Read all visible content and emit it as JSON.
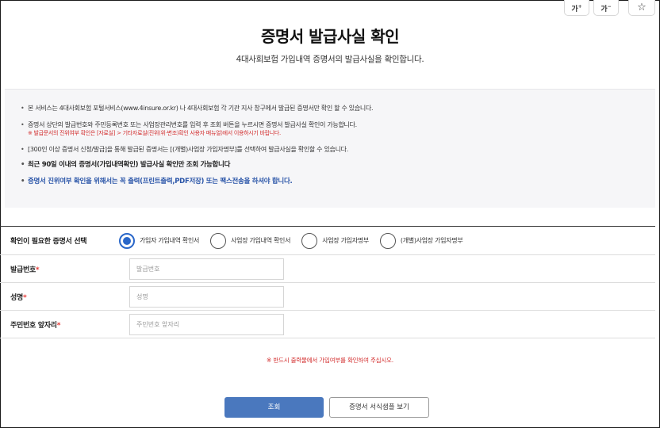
{
  "toolbar": {
    "font_up": "가",
    "font_up_mark": "+",
    "font_down": "가",
    "font_down_mark": "−",
    "favorite_glyph": "☆"
  },
  "header": {
    "title": "증명서 발급사실 확인",
    "subtitle": "4대사회보험 가입내역 증명서의 발급사실을 확인합니다."
  },
  "notice": {
    "item1": "본 서비스는 4대사회보험 포털서비스(www.4insure.or.kr) 나 4대사회보험 각 기관 지사 창구에서 발급된 증명서만 확인 할 수 있습니다.",
    "item2": "증명서 상단의 발급번호와 주민등록번호 또는 사업장관리번호를 입력 후 조회 버튼을 누르시면 증명서 발급사실 확인이 가능합니다.",
    "item2_note": "※ 발급문서의 진위여부 확인은 [자료실] > 기타자료실(진위(위·변조)확인 사용자 매뉴얼)에서 이용하시기 바랍니다.",
    "item3": "[300인 이상 증명서 신청/발급]을 통해 발급된 증명서는 [(개별)사업장 가입자명부]를 선택하여 발급사실을 확인할 수 있습니다.",
    "item4": "최근 90일 이내의 증명서(가입내역확인) 발급사실 확인만 조회 가능합니다",
    "item5": "증명서 진위여부 확인을 위해서는 꼭 출력(프린트출력,PDF저장) 또는 팩스전송을 하셔야 합니다."
  },
  "form": {
    "cert_type_label": "확인이 필요한 증명서 선택",
    "cert_options": [
      {
        "label": "가입자 가입내역 확인서",
        "selected": true
      },
      {
        "label": "사업장 가입내역 확인서",
        "selected": false
      },
      {
        "label": "사업장 가입자명부",
        "selected": false
      },
      {
        "label": "(개별)사업장 가입자명부",
        "selected": false
      }
    ],
    "issue_no_label": "발급번호",
    "issue_no_placeholder": "발급번호",
    "name_label": "성명",
    "name_placeholder": "성명",
    "rrn_label": "주민번호 앞자리",
    "rrn_placeholder": "주민번호 앞자리",
    "required_mark": "*"
  },
  "warning": "※ 반드시 출력물에서 가입여부를 확인하여 주십시오.",
  "buttons": {
    "query": "조회",
    "sample": "증명서 서식샘플 보기"
  },
  "colors": {
    "primary": "#4a78be",
    "radio_selected": "#2a67c9",
    "required": "#e53935",
    "warning": "#d32f2f",
    "link_blue": "#2a55a8"
  }
}
